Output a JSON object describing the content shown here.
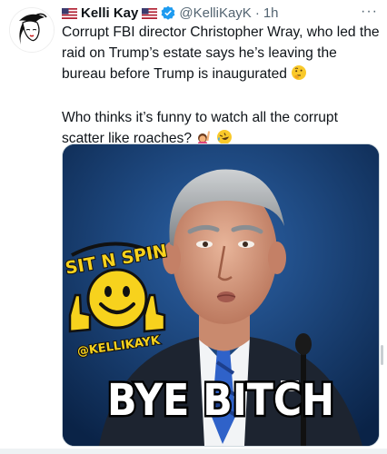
{
  "tweet": {
    "display_name": "Kelli Kay",
    "handle": "@KelliKayK",
    "separator": "·",
    "time": "1h",
    "more": "···",
    "paragraph1": "Corrupt FBI director Christopher Wray, who led the raid on Trump’s estate says he’s leaving the bureau before Trump is inaugurated",
    "paragraph2": "Who thinks it’s funny to watch all the corrupt scatter like roaches?",
    "icons": [
      "us-flag-icon",
      "verified-badge-icon",
      "thinking-face-emoji",
      "raising-hand-emoji",
      "rolling-laughing-emoji"
    ]
  },
  "media": {
    "sticker_top": "SIT N SPIN",
    "sticker_bottom": "@KELLIKAYK",
    "caption": "BYE BITCH"
  },
  "colors": {
    "verified": "#1d9bf0",
    "sticker_yellow": "#f7d21d",
    "background_blue": "#1a4a86"
  }
}
